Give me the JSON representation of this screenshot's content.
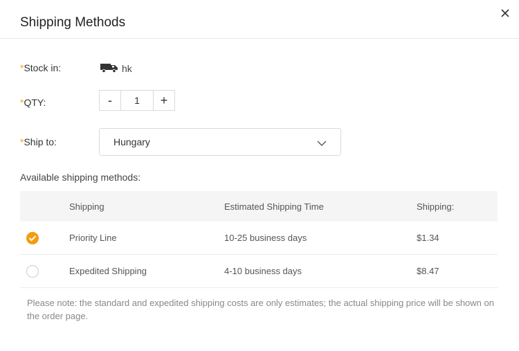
{
  "dialog": {
    "title": "Shipping Methods",
    "close_icon": "close-icon"
  },
  "form": {
    "required_mark": "*",
    "stock_label": "Stock in:",
    "stock_icon": "truck-icon",
    "stock_value": "hk",
    "qty_label": "QTY:",
    "qty_minus": "-",
    "qty_value": "1",
    "qty_plus": "+",
    "ship_to_label": "Ship to:",
    "ship_to_value": "Hungary"
  },
  "shipping": {
    "available_label": "Available shipping methods:",
    "headers": {
      "shipping": "Shipping",
      "time": "Estimated Shipping Time",
      "cost": "Shipping:"
    },
    "rows": [
      {
        "selected": true,
        "name": "Priority Line",
        "time": "10-25 business days",
        "cost": "$1.34"
      },
      {
        "selected": false,
        "name": "Expedited Shipping",
        "time": "4-10 business days",
        "cost": "$8.47"
      }
    ]
  },
  "note": "Please note: the standard and expedited shipping costs are only estimates; the actual shipping price will be shown on the order page.",
  "colors": {
    "accent": "#f39c12",
    "required": "#f5a623"
  }
}
